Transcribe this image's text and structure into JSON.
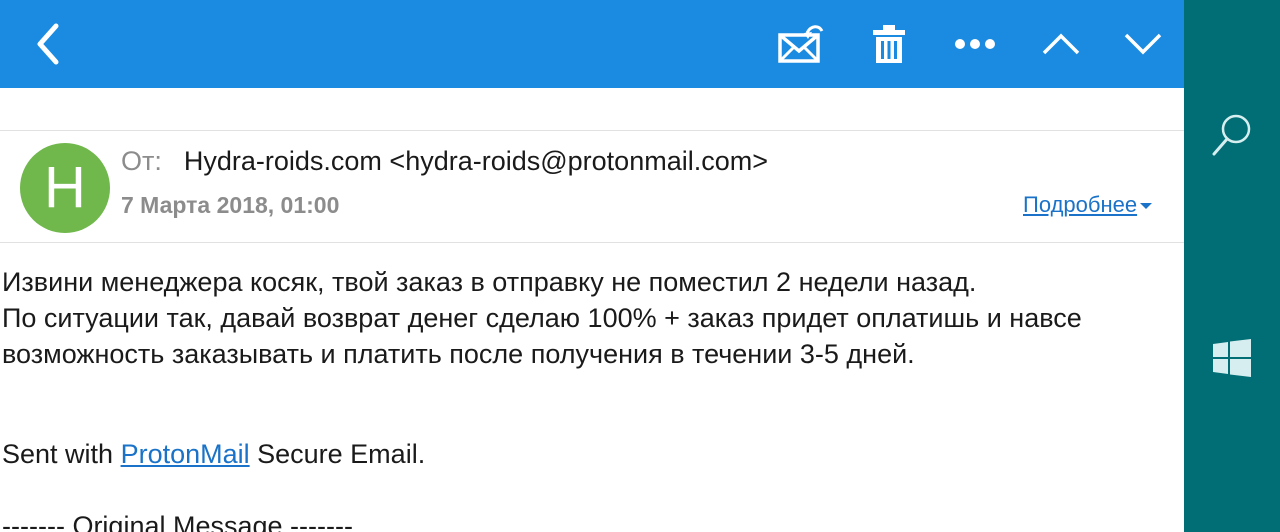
{
  "toolbar": {
    "back_icon": "chevron-left-icon",
    "actions": [
      "mark-unread-icon",
      "trash-icon",
      "more-icon",
      "chevron-up-icon",
      "chevron-down-icon"
    ],
    "background_color": "#1a8be0"
  },
  "message": {
    "avatar_letter": "H",
    "avatar_color": "#70b74c",
    "from_label": "От:",
    "from_value": "Hydra-roids.com <hydra-roids@protonmail.com>",
    "date": "7 Марта 2018, 01:00",
    "details_link": "Подробнее",
    "body_lines": [
      "Извини менеджера косяк, твой заказ в отправку не поместил 2 недели назад.",
      "По ситуации так, давай возврат денег сделаю 100% + заказ придет оплатишь и навсе",
      "возможность заказывать и платить после получения в течении 3-5 дней."
    ],
    "signature_prefix": "Sent with ",
    "signature_link": "ProtonMail",
    "signature_suffix": " Secure Email.",
    "original_message": "------- Original Message -------"
  },
  "charms": {
    "background_color": "#006e74",
    "items": [
      "search-icon",
      "windows-start-icon"
    ]
  }
}
